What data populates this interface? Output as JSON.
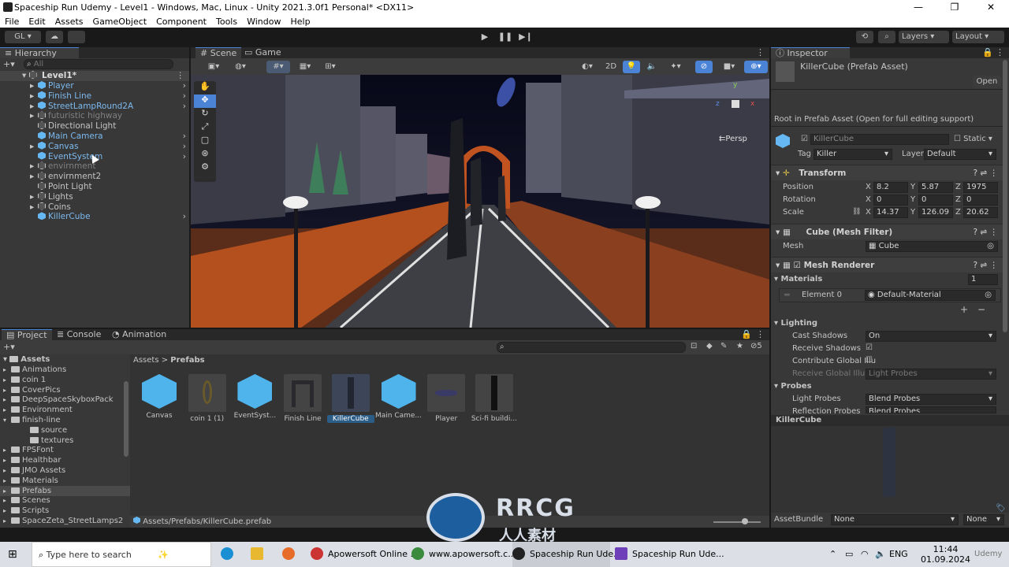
{
  "window": {
    "title": "Spaceship Run Udemy - Level1 - Windows, Mac, Linux - Unity 2021.3.0f1 Personal* <DX11>",
    "controls": [
      "—",
      "❐",
      "✕"
    ]
  },
  "menu": [
    "File",
    "Edit",
    "Assets",
    "GameObject",
    "Component",
    "Tools",
    "Window",
    "Help"
  ],
  "toolbar": {
    "account": "GL ▾",
    "layers_label": "Layers",
    "layout_label": "Layout"
  },
  "hierarchy": {
    "tab": "Hierarchy",
    "search_placeholder": "All",
    "scene": "Level1*",
    "items": [
      {
        "label": "Player",
        "style": "blue",
        "expand": true
      },
      {
        "label": "Finish Line",
        "style": "blue",
        "expand": true
      },
      {
        "label": "StreetLampRound2A",
        "style": "blue",
        "expand": true
      },
      {
        "label": "futuristic highway",
        "style": "dim",
        "expand": true
      },
      {
        "label": "Directional Light",
        "style": "",
        "expand": false
      },
      {
        "label": "Main Camera",
        "style": "blue",
        "expand": false
      },
      {
        "label": "Canvas",
        "style": "blue",
        "expand": true
      },
      {
        "label": "EventSystem",
        "style": "blue",
        "expand": false
      },
      {
        "label": "envirnment",
        "style": "dim",
        "expand": true
      },
      {
        "label": "envirnment2",
        "style": "",
        "expand": true
      },
      {
        "label": "Point Light",
        "style": "",
        "expand": false
      },
      {
        "label": "Lights",
        "style": "",
        "expand": true
      },
      {
        "label": "Coins",
        "style": "",
        "expand": true
      },
      {
        "label": "KillerCube",
        "style": "blue",
        "expand": false
      }
    ]
  },
  "scene": {
    "tabs": [
      "Scene",
      "Game"
    ],
    "toggle_2d": "2D",
    "persp_label": "Persp",
    "gizmo_axes": {
      "y": "y",
      "x": "x",
      "z": "z"
    }
  },
  "project": {
    "tabs": [
      "Project",
      "Console",
      "Animation"
    ],
    "hidden_count": "5",
    "breadcrumb": [
      "Assets",
      "Prefabs"
    ],
    "root": "Assets",
    "folders": [
      "Animations",
      "coin 1",
      "CoverPics",
      "DeepSpaceSkyboxPack",
      "Environment",
      "finish-line",
      "source",
      "textures",
      "FPSFont",
      "Healthbar",
      "JMO Assets",
      "Materials",
      "Prefabs",
      "Scenes",
      "Scripts",
      "SpaceZeta_StreetLamps2"
    ],
    "assets": [
      {
        "label": "Canvas",
        "kind": "cube"
      },
      {
        "label": "coin 1 (1)",
        "kind": "coin"
      },
      {
        "label": "EventSyst...",
        "kind": "cube"
      },
      {
        "label": "Finish Line",
        "kind": "gate"
      },
      {
        "label": "KillerCube",
        "kind": "pillar"
      },
      {
        "label": "Main Came...",
        "kind": "cube"
      },
      {
        "label": "Player",
        "kind": "ship"
      },
      {
        "label": "Sci-fi buildi...",
        "kind": "tower"
      }
    ],
    "footer_path": "Assets/Prefabs/KillerCube.prefab"
  },
  "inspector": {
    "tab": "Inspector",
    "header_title": "KillerCube (Prefab Asset)",
    "open_button": "Open",
    "root_note": "Root in Prefab Asset (Open for full editing support)",
    "name_value": "KillerCube",
    "static_label": "Static",
    "tag_label": "Tag",
    "tag_value": "Killer",
    "layer_label": "Layer",
    "layer_value": "Default",
    "transform": {
      "title": "Transform",
      "position_label": "Position",
      "rotation_label": "Rotation",
      "scale_label": "Scale",
      "position": {
        "x": "8.2",
        "y": "5.87",
        "z": "1975"
      },
      "rotation": {
        "x": "0",
        "y": "0",
        "z": "0"
      },
      "scale": {
        "x": "14.37",
        "y": "126.09",
        "z": "20.62"
      }
    },
    "mesh_filter": {
      "title": "Cube (Mesh Filter)",
      "mesh_label": "Mesh",
      "mesh_value": "Cube"
    },
    "mesh_renderer": {
      "title": "Mesh Renderer",
      "materials_label": "Materials",
      "materials_count": "1",
      "element_label": "Element 0",
      "element_value": "Default-Material"
    },
    "lighting": {
      "title": "Lighting",
      "cast_label": "Cast Shadows",
      "cast_value": "On",
      "receive_label": "Receive Shadows",
      "contribute_label": "Contribute Global Illu",
      "receive_gi_label": "Receive Global Illum",
      "receive_gi_value": "Light Probes"
    },
    "probes": {
      "title": "Probes",
      "light_label": "Light Probes",
      "light_value": "Blend Probes",
      "reflection_label": "Reflection Probes",
      "reflection_value": "Blend Probes"
    },
    "preview_title": "KillerCube",
    "asset_bundle_label": "AssetBundle",
    "asset_bundle_value": "None",
    "asset_variant_value": "None"
  },
  "taskbar": {
    "search_placeholder": "Type here to search",
    "tasks": [
      "Apowersoft Online ...",
      "www.apowersoft.c...",
      "Spaceship Run Ude...",
      "Spaceship Run Ude..."
    ],
    "lang": "ENG",
    "time": "11:44",
    "date": "01.09.2024"
  },
  "watermark": {
    "brand": "RRCG",
    "sub": "人人素材",
    "udemy": "Udemy"
  },
  "colors": {
    "accent": "#4b83d6",
    "prefab_blue": "#7cb9ef",
    "panel": "#383838",
    "road_orange": "#b4501e"
  }
}
